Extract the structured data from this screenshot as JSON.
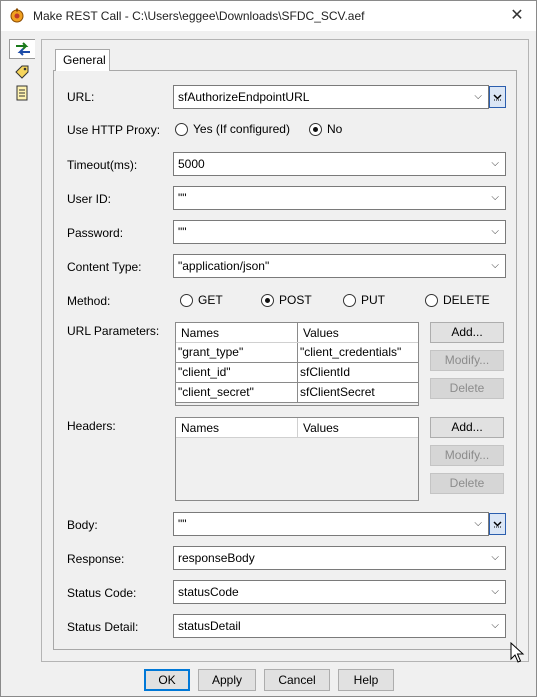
{
  "window": {
    "title": "Make REST Call - C:\\Users\\eggee\\Downloads\\SFDC_SCV.aef",
    "close_glyph": "✕"
  },
  "tabs": {
    "general": "General"
  },
  "form": {
    "url": {
      "label": "URL:",
      "value": "sfAuthorizeEndpointURL"
    },
    "proxy": {
      "label": "Use HTTP Proxy:",
      "option_yes": "Yes (If configured)",
      "option_no": "No",
      "selected": "No"
    },
    "timeout": {
      "label": "Timeout(ms):",
      "value": "5000"
    },
    "user_id": {
      "label": "User ID:",
      "value": "\"\""
    },
    "password": {
      "label": "Password:",
      "value": "\"\""
    },
    "content_type": {
      "label": "Content Type:",
      "value": "\"application/json\""
    },
    "method": {
      "label": "Method:",
      "options": [
        "GET",
        "POST",
        "PUT",
        "DELETE"
      ],
      "selected": "POST"
    },
    "url_params": {
      "label": "URL Parameters:",
      "columns": [
        "Names",
        "Values"
      ],
      "rows": [
        [
          "\"grant_type\"",
          "\"client_credentials\""
        ],
        [
          "\"client_id\"",
          "sfClientId"
        ],
        [
          "\"client_secret\"",
          "sfClientSecret"
        ]
      ]
    },
    "headers": {
      "label": "Headers:",
      "columns": [
        "Names",
        "Values"
      ]
    },
    "body": {
      "label": "Body:",
      "value": "\"\""
    },
    "response": {
      "label": "Response:",
      "value": "responseBody"
    },
    "status_code": {
      "label": "Status Code:",
      "value": "statusCode"
    },
    "status_detail": {
      "label": "Status Detail:",
      "value": "statusDetail"
    },
    "buttons": {
      "add": "Add...",
      "modify": "Modify...",
      "delete": "Delete"
    }
  },
  "footer": {
    "ok": "OK",
    "apply": "Apply",
    "cancel": "Cancel",
    "help": "Help"
  },
  "colors": {
    "accent": "#0078d7",
    "ellipsis_border": "#2b5eae"
  }
}
